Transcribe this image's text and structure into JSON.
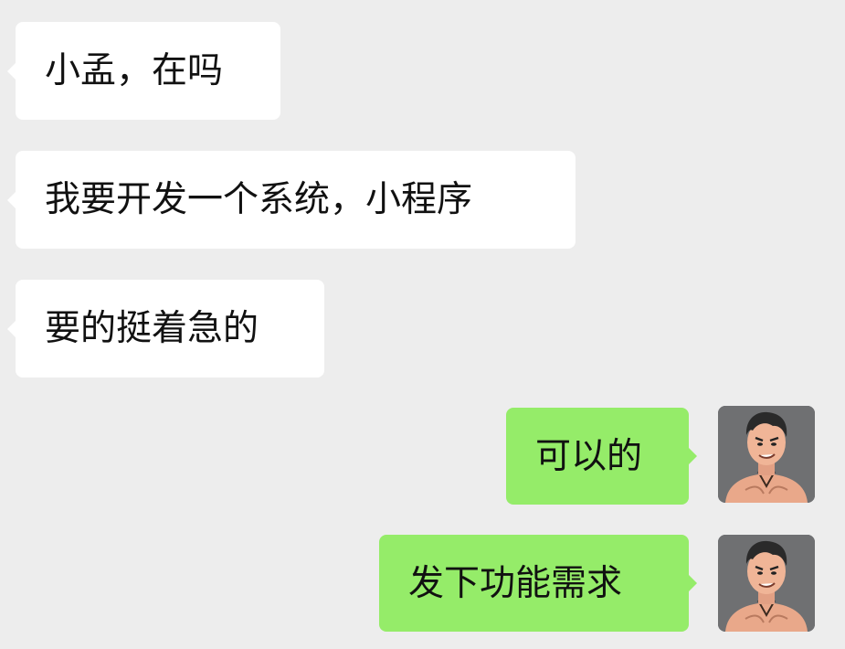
{
  "messages": [
    {
      "side": "left",
      "text": "小孟，在吗"
    },
    {
      "side": "left",
      "text": "我要开发一个系统，小程序"
    },
    {
      "side": "left",
      "text": "要的挺着急的"
    },
    {
      "side": "right",
      "text": "可以的"
    },
    {
      "side": "right",
      "text": "发下功能需求"
    }
  ],
  "colors": {
    "background": "#ededed",
    "incoming_bubble": "#ffffff",
    "outgoing_bubble": "#95ec69",
    "avatar_background": "#6f7072"
  },
  "icons": {
    "avatar": "cartoon-muscular-man-avatar-icon"
  }
}
